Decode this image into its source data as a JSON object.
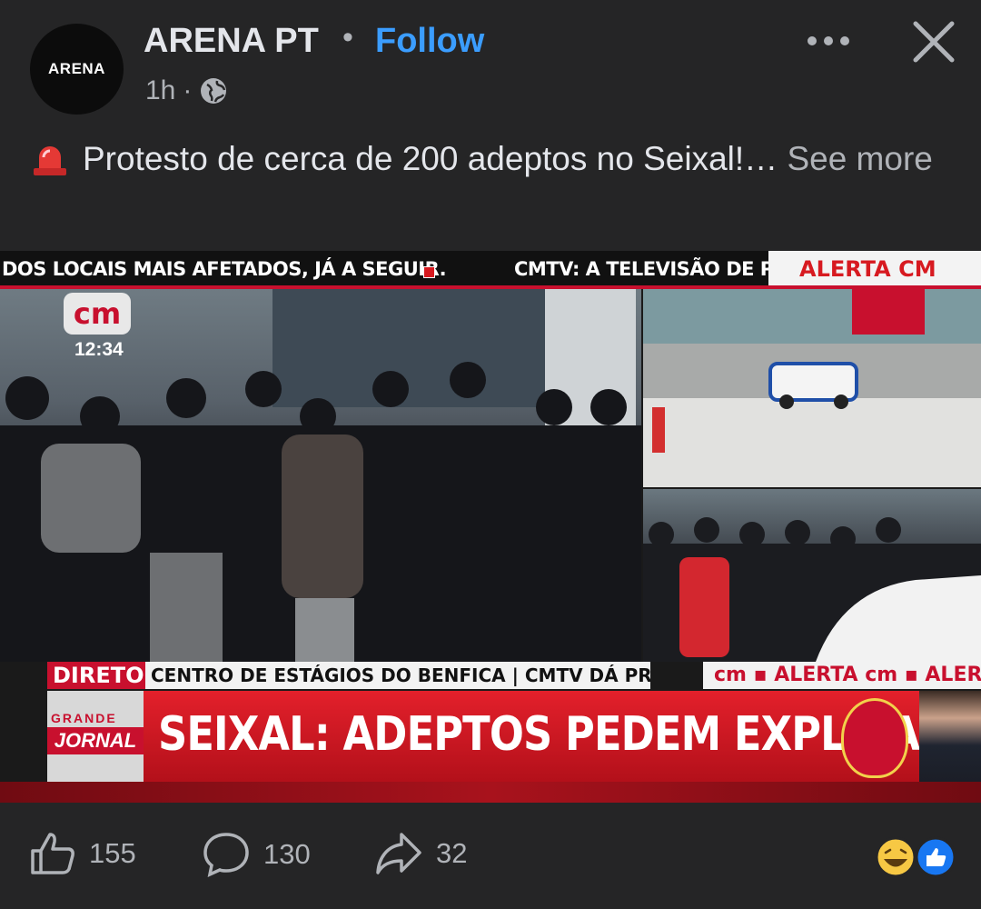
{
  "header": {
    "avatar_text": "ARENA",
    "page_name": "ARENA PT",
    "separator": "•",
    "follow_label": "Follow",
    "time": "1h",
    "meta_dot": "·",
    "audience_icon": "globe-icon",
    "more_icon": "more-dots-icon",
    "close_icon": "close-icon"
  },
  "post": {
    "emoji_icon": "police-siren-icon",
    "text": "Protesto de cerca de 200 adeptos no Seixal!…",
    "see_more": "See more"
  },
  "media": {
    "ticker_left": "DOS LOCAIS MAIS AFETADOS, JÁ A SEGUIR.",
    "ticker_right": "CMTV: A TELEVISÃO DE POR",
    "alerta_top": "ALERTA CM",
    "channel_logo": "cm",
    "clock": "12:34",
    "direto": "DIRETO",
    "subheadline": "CENTRO DE ESTÁGIOS DO BENFICA | CMTV DÁ PRIMEIRO",
    "alerta_strip": "cm ▪ ALERTA cm ▪ ALERTA",
    "grande_top": "GRANDE",
    "grande_bottom": "JORNAL",
    "headline": "SEIXAL: ADEPTOS PEDEM EXPLICAÇÕES"
  },
  "actions": {
    "like_count": "155",
    "comment_count": "130",
    "share_count": "32",
    "like_icon": "thumbs-up-icon",
    "comment_icon": "comment-bubble-icon",
    "share_icon": "share-arrow-icon",
    "reactions": [
      "laughing-face-icon",
      "like-reaction-icon"
    ]
  },
  "colors": {
    "background": "#252526",
    "text": "#e4e6eb",
    "secondary": "#b0b3b8",
    "follow": "#3b9dff",
    "cm_red": "#c8102e"
  }
}
